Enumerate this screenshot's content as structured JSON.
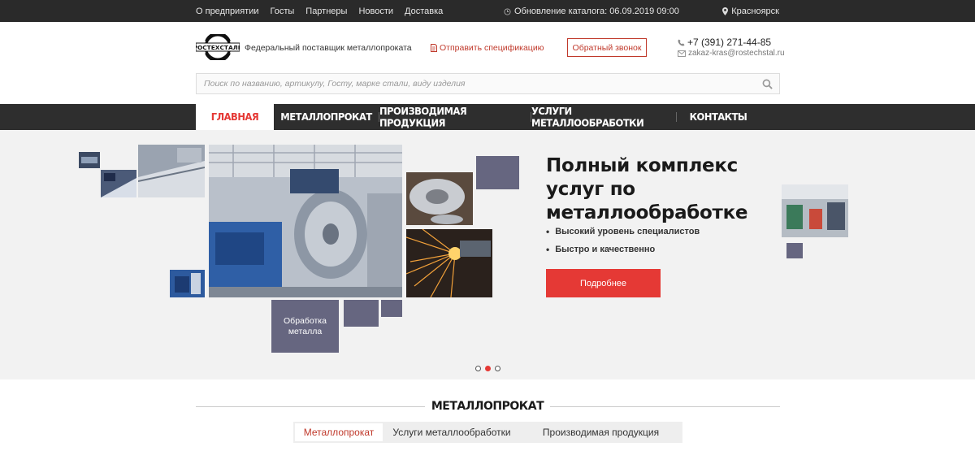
{
  "topbar": {
    "nav": [
      "О предприятии",
      "Госты",
      "Партнеры",
      "Новости",
      "Доставка"
    ],
    "update_text": "Обновление каталога: 06.09.2019 09:00",
    "city": "Красноярск"
  },
  "header": {
    "logo_text": "РОСТЕХСТАЛЬ",
    "tagline": "Федеральный поставщик металлопроката",
    "spec_link": "Отправить спецификацию",
    "callback_button": "Обратный звонок",
    "phone": "+7 (391) 271-44-85",
    "email": "zakaz-kras@rostechstal.ru"
  },
  "search": {
    "placeholder": "Поиск по названию, артикулу, Госту, марке стали, виду изделия"
  },
  "main_nav": {
    "items": [
      "Главная",
      "Металлопрокат",
      "Производимая продукция",
      "Услуги металлообработки",
      "Контакты"
    ],
    "active_index": 0
  },
  "hero": {
    "title": "Полный комплекс услуг по металлообработке",
    "bullets": [
      "Высокий уровень специалистов",
      "Быстро и качественно"
    ],
    "button": "Подробнее",
    "tile_caption": "Обработка металла",
    "slides_count": 3,
    "active_slide": 1
  },
  "section": {
    "title": "МЕТАЛЛОПРОКАТ",
    "tabs": [
      "Металлопрокат",
      "Услуги металлообработки",
      "Производимая продукция"
    ],
    "active_tab": 0
  },
  "colors": {
    "accent": "#e53935",
    "dark_bar": "#2a2a2a",
    "tile": "#666680"
  }
}
